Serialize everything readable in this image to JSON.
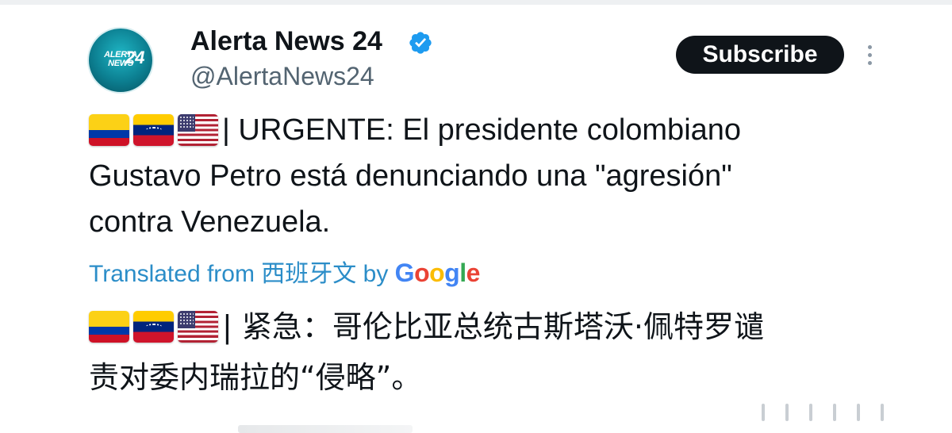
{
  "account": {
    "avatar_text_line1": "ALERTA",
    "avatar_text_line2": "NEWS",
    "avatar_number": "24",
    "display_name": "Alerta News 24",
    "handle": "@AlertaNews24",
    "verified_icon": "verified-badge-icon",
    "verified_color": "#1d9bf0"
  },
  "actions": {
    "subscribe_label": "Subscribe",
    "more_icon": "more-vertical-icon"
  },
  "tweet": {
    "flags": [
      "colombia-flag-icon",
      "venezuela-flag-icon",
      "usa-flag-icon"
    ],
    "line1": " | URGENTE: El presidente colombiano",
    "line2": "Gustavo Petro está denunciando una \"agresión\"",
    "line3": "contra Venezuela."
  },
  "translation": {
    "label": "Translated from 西班牙文 by",
    "brand": [
      "G",
      "o",
      "o",
      "g",
      "l",
      "e"
    ],
    "line1": " | 紧急：哥伦比亚总统古斯塔沃·佩特罗谴",
    "line2": "责对委内瑞拉的“侵略”。"
  },
  "colors": {
    "text": "#0f1419",
    "secondary": "#536471",
    "link": "#1d9bf0",
    "button_bg": "#0f1419"
  }
}
